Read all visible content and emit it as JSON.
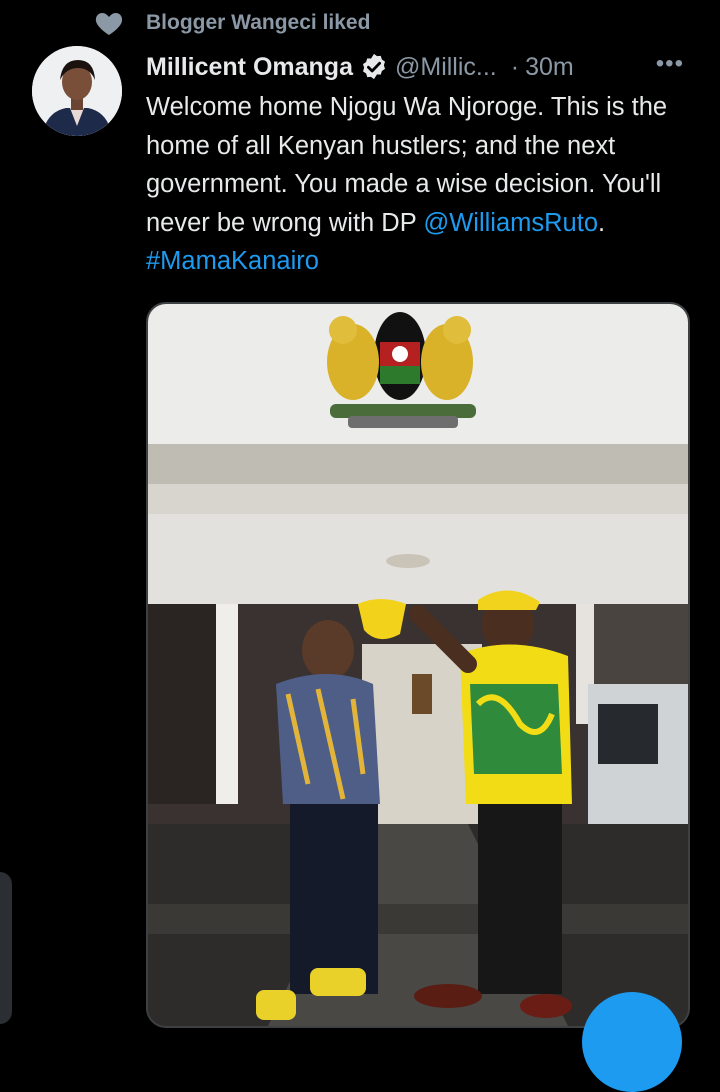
{
  "context": {
    "icon": "heart-icon",
    "text": "Blogger Wangeci liked"
  },
  "tweet": {
    "author_name": "Millicent Omanga",
    "verified_icon": "verified-badge-icon",
    "handle": "@Millic...",
    "time": "30m",
    "more_icon": "more-options-icon",
    "text_part1": "Welcome home Njogu Wa Njoroge. This is the home of all Kenyan hustlers; and the next government. You made a wise decision. You'll never be wrong with DP ",
    "mention": "@WilliamsRuto",
    "text_part2": ". ",
    "hashtag": "#MamaKanairo"
  },
  "fab_icon": "compose-tweet-icon",
  "colors": {
    "background": "#000000",
    "text": "#e7e9ea",
    "secondary": "#8b98a5",
    "link": "#1d9bf0",
    "media_border": "#3e4144"
  }
}
